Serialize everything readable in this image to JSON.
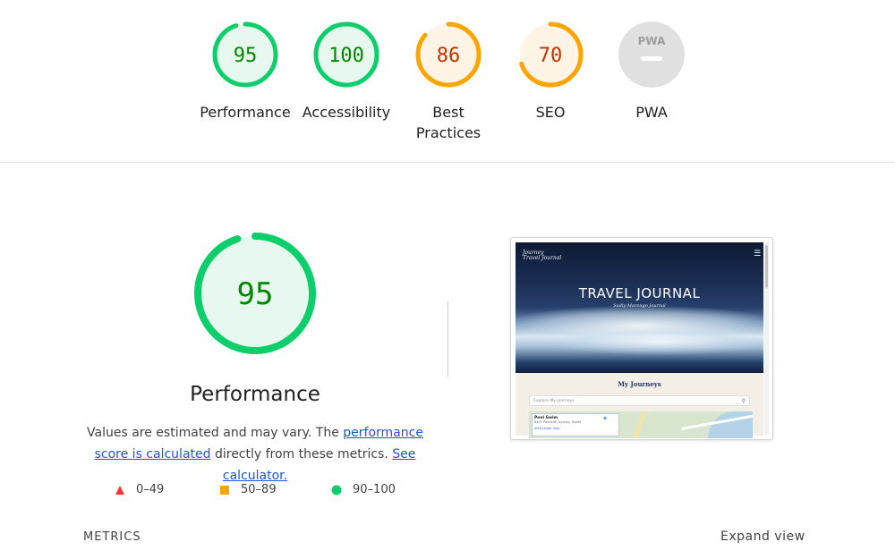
{
  "top_gauges": [
    {
      "score": "95",
      "label": "Performance",
      "level": "pass",
      "fraction": 0.95,
      "color": "#0cce6b",
      "fill": "#e7f8ee",
      "text_color": "#008800"
    },
    {
      "score": "100",
      "label": "Accessibility",
      "level": "pass",
      "fraction": 1.0,
      "color": "#0cce6b",
      "fill": "#e7f8ee",
      "text_color": "#008800"
    },
    {
      "score": "86",
      "label": "Best Practices",
      "level": "average",
      "fraction": 0.86,
      "color": "#ffa400",
      "fill": "#fff4e5",
      "text_color": "#c33300"
    },
    {
      "score": "70",
      "label": "SEO",
      "level": "average",
      "fraction": 0.7,
      "color": "#ffa400",
      "fill": "#fff4e5",
      "text_color": "#c33300"
    },
    {
      "score": "",
      "label": "PWA",
      "level": "na",
      "badge": "PWA",
      "color": "#e0e0e0",
      "fill": "#e0e0e0"
    }
  ],
  "performance": {
    "score": "95",
    "fraction": 0.95,
    "title": "Performance",
    "desc_part1": "Values are estimated and may vary. The ",
    "desc_link1": "performance score is calculated",
    "desc_part2": " directly from these metrics. ",
    "desc_link2": "See calculator.",
    "ring_color": "#0cce6b",
    "fill_color": "#e7f8ee",
    "text_color": "#008800"
  },
  "legend": [
    {
      "icon": "red-triangle-icon",
      "label": "0–49",
      "color": "#ff3333"
    },
    {
      "icon": "orange-square-icon",
      "label": "50–89",
      "color": "#ffa400"
    },
    {
      "icon": "green-circle-icon",
      "label": "90–100",
      "color": "#0cce6b"
    }
  ],
  "screenshot": {
    "logo_line1": "Journey",
    "logo_line2": "Travel Journal",
    "menu_icon": "☰",
    "title": "TRAVEL JOURNAL",
    "subtitle": "Sadly Marengo Journal",
    "section_title": "My Journeys",
    "search_placeholder": "Explore My Journeys",
    "card_title": "Pool Swim",
    "card_address": "8497 Parkside, Sydney, Ballet",
    "card_link": "View larger map",
    "pin_label": "Rosedring"
  },
  "footer": {
    "metrics_label": "METRICS",
    "expand_label": "Expand view"
  }
}
